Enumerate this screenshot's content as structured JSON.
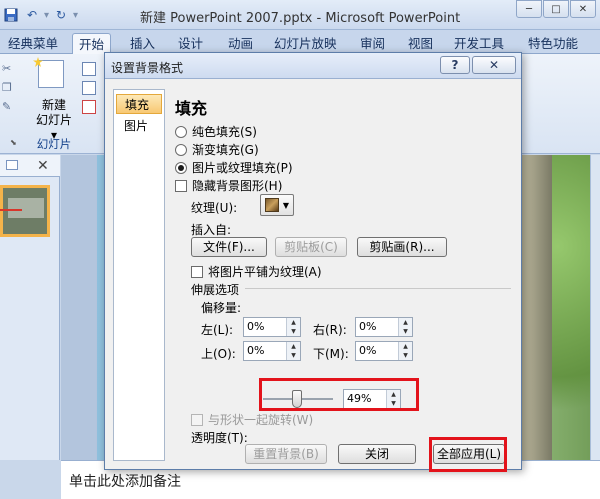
{
  "window": {
    "title": "新建 PowerPoint 2007.pptx - Microsoft PowerPoint",
    "min_glyph": "─",
    "max_glyph": "□",
    "close_glyph": "✕"
  },
  "qat": {
    "save_icon": "save-icon",
    "undo_glyph": "↶",
    "redo_glyph": "↻",
    "dropdown_glyph": "▾"
  },
  "ribbon_tabs": [
    "经典菜单",
    "开始",
    "插入",
    "设计",
    "动画",
    "幻灯片放映",
    "审阅",
    "视图",
    "开发工具",
    "特色功能"
  ],
  "active_tab": "开始",
  "slides_group": {
    "new_slide_label": "新建\n幻灯片",
    "new_slide_label_line1": "新建",
    "new_slide_label_line2": "幻灯片 ▾",
    "group_name": "幻灯片"
  },
  "left_pane": {
    "close_glyph": "✕"
  },
  "notes": {
    "placeholder": "单击此处添加备注"
  },
  "dialog": {
    "title": "设置背景格式",
    "help_glyph": "?",
    "close_glyph": "✕",
    "nav": [
      "填充",
      "图片"
    ],
    "selected_nav": "填充",
    "section_title": "填充",
    "fill_options": [
      {
        "label": "纯色填充(S)",
        "selected": false
      },
      {
        "label": "渐变填充(G)",
        "selected": false
      },
      {
        "label": "图片或纹理填充(P)",
        "selected": true
      }
    ],
    "hide_bg_graphics": {
      "label": "隐藏背景图形(H)",
      "checked": false
    },
    "texture_label": "纹理(U):",
    "insert_from_label": "插入自:",
    "file_button": "文件(F)...",
    "clipboard_button": "剪贴板(C)",
    "clipart_button": "剪贴画(R)...",
    "tile_checkbox": {
      "label": "将图片平铺为纹理(A)",
      "checked": false
    },
    "stretch_options_label": "伸展选项",
    "offset_label": "偏移量:",
    "offsets": {
      "left": {
        "label": "左(L):",
        "value": "0%"
      },
      "right": {
        "label": "右(R):",
        "value": "0%"
      },
      "top": {
        "label": "上(O):",
        "value": "0%"
      },
      "bottom": {
        "label": "下(M):",
        "value": "0%"
      }
    },
    "transparency_label": "透明度(T):",
    "transparency_value": "49%",
    "transparency_fraction": 0.49,
    "rotate_with_shape": {
      "label": "与形状一起旋转(W)",
      "checked": false,
      "disabled": true
    },
    "reset_button": "重置背景(B)",
    "close_button": "关闭",
    "apply_all_button": "全部应用(L)"
  },
  "colors": {
    "highlight_red": "#e3131b",
    "selected_nav": "#f8c873",
    "ribbon_blue": "#c7d6ec"
  }
}
